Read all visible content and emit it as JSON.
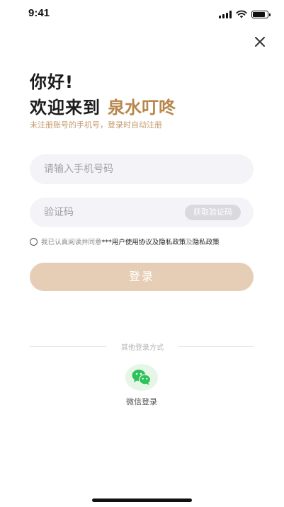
{
  "status_bar": {
    "time": "9:41",
    "battery_level": 0.85
  },
  "header": {
    "greeting": "你好!",
    "welcome": "欢迎来到",
    "brand": "泉水叮咚",
    "subtitle": "未注册账号的手机号，登录时自动注册"
  },
  "form": {
    "phone_placeholder": "请输入手机号码",
    "phone_value": "",
    "code_placeholder": "验证码",
    "code_value": "",
    "get_code_label": "获取验证码"
  },
  "agreement": {
    "prefix": "我已认真阅读并同意",
    "user_agreement": "***用户使用协议及隐私政策",
    "and": "及",
    "privacy_policy": "隐私政策",
    "checked": false
  },
  "login_button": "登录",
  "other_login": {
    "label": "其他登录方式",
    "wechat_label": "微信登录",
    "wechat_icon": "wechat-icon"
  },
  "colors": {
    "brand": "#b8874c",
    "subtitle": "#c49a6c",
    "login_button": "#e6ceb6",
    "input_bg": "#f4f4f8",
    "wechat_green": "#2ec25a"
  }
}
